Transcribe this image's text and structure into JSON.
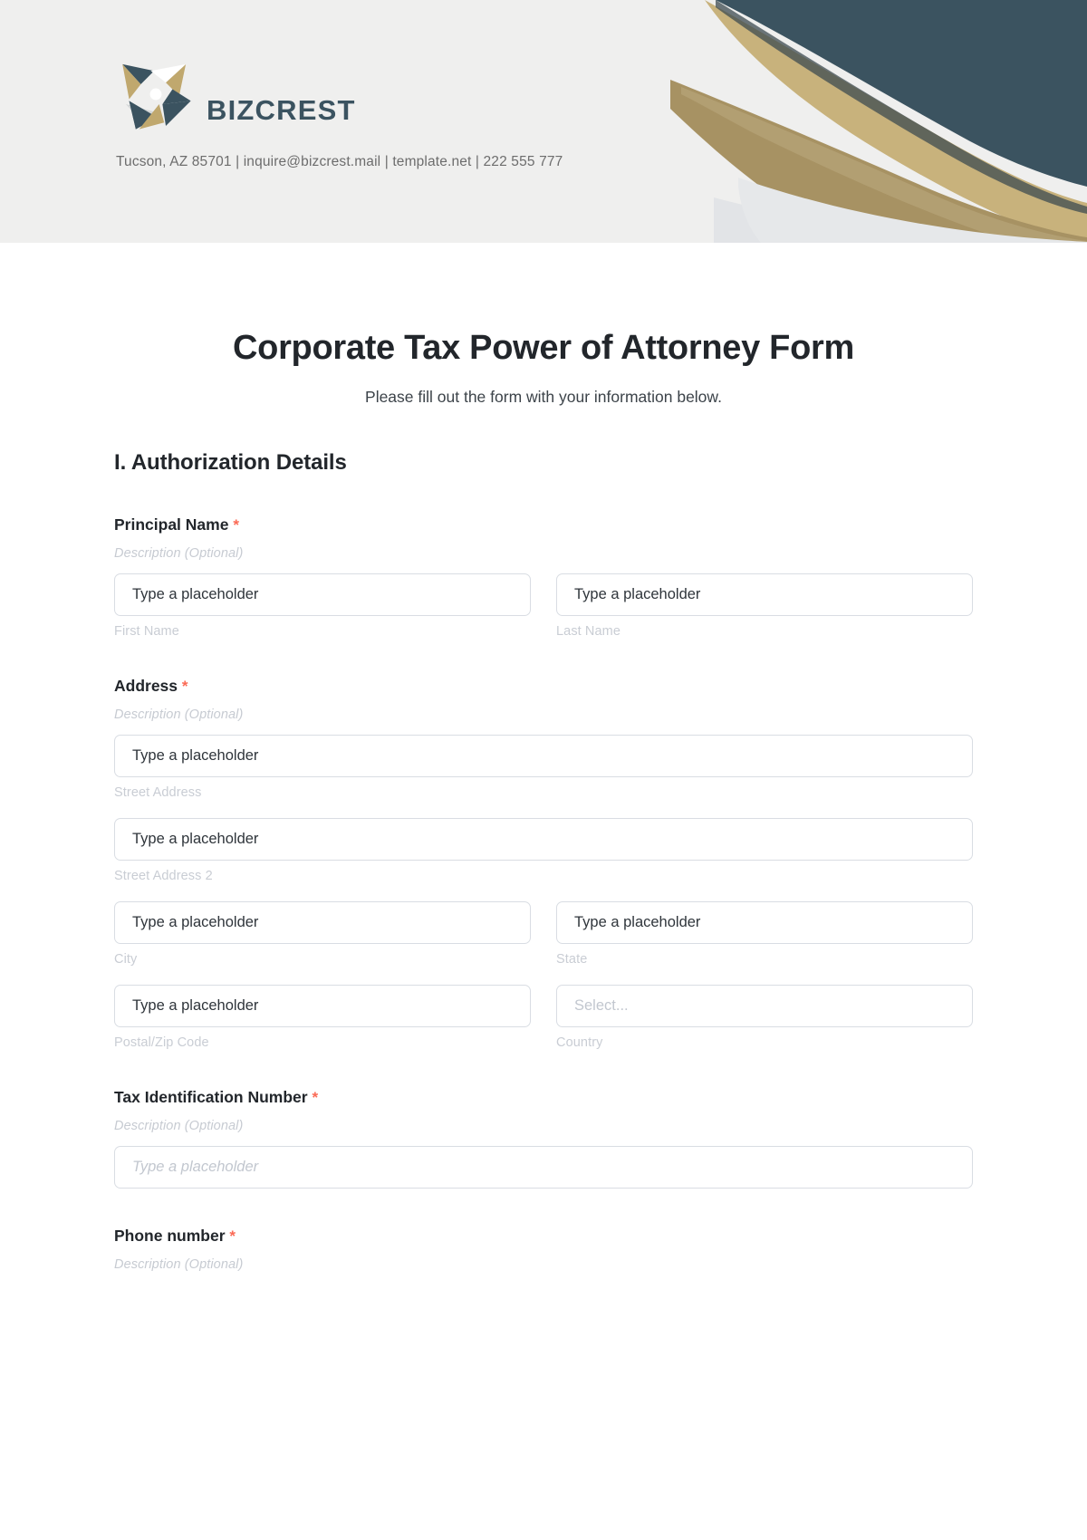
{
  "header": {
    "brand_name": "BIZCREST",
    "contact_line": "Tucson, AZ 85701 | inquire@bizcrest.mail | template.net | 222 555 777",
    "colors": {
      "background": "#efefee",
      "dark_slate": "#3b5360",
      "gold_light": "#c8b27c",
      "gold_dark": "#a79263",
      "gray_wave": "#e2e4e7"
    }
  },
  "form": {
    "title": "Corporate Tax Power of Attorney Form",
    "subtitle": "Please fill out the form with your information below.",
    "required_marker": "*",
    "accent_required_color": "#fb6a55",
    "sections": [
      {
        "heading": "I. Authorization Details",
        "fields": [
          {
            "label": "Principal Name",
            "description": "Description (Optional)",
            "inputs": [
              {
                "placeholder": "Type a placeholder",
                "sub_label": "First Name"
              },
              {
                "placeholder": "Type a placeholder",
                "sub_label": "Last Name"
              }
            ]
          },
          {
            "label": "Address",
            "description": "Description (Optional)",
            "inputs": [
              {
                "placeholder": "Type a placeholder",
                "sub_label": "Street Address"
              },
              {
                "placeholder": "Type a placeholder",
                "sub_label": "Street Address 2"
              },
              {
                "placeholder": "Type a placeholder",
                "sub_label": "City"
              },
              {
                "placeholder": "Type a placeholder",
                "sub_label": "State"
              },
              {
                "placeholder": "Type a placeholder",
                "sub_label": "Postal/Zip Code"
              },
              {
                "placeholder": "Select...",
                "sub_label": "Country"
              }
            ]
          },
          {
            "label": "Tax Identification Number",
            "description": "Description (Optional)",
            "inputs": [
              {
                "placeholder": "Type a placeholder",
                "sub_label": ""
              }
            ]
          },
          {
            "label": "Phone number",
            "description": "Description (Optional)",
            "inputs": []
          }
        ]
      }
    ]
  }
}
